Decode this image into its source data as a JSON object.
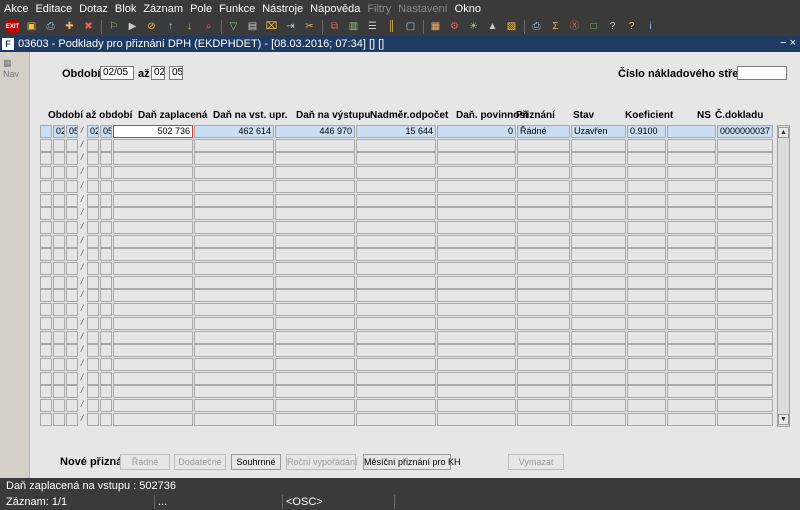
{
  "menu": {
    "items": [
      {
        "label": "Akce",
        "enabled": true
      },
      {
        "label": "Editace",
        "enabled": true
      },
      {
        "label": "Dotaz",
        "enabled": true
      },
      {
        "label": "Blok",
        "enabled": true
      },
      {
        "label": "Záznam",
        "enabled": true
      },
      {
        "label": "Pole",
        "enabled": true
      },
      {
        "label": "Funkce",
        "enabled": true
      },
      {
        "label": "Nástroje",
        "enabled": true
      },
      {
        "label": "Nápověda",
        "enabled": true
      },
      {
        "label": "Filtry",
        "enabled": false
      },
      {
        "label": "Nastavení",
        "enabled": false
      },
      {
        "label": "Okno",
        "enabled": true
      }
    ]
  },
  "toolbar": {
    "exit_label": "EXIT",
    "icons": [
      "save-icon",
      "print-icon",
      "new-record-icon",
      "delete-record-icon",
      "enter-query-icon",
      "execute-query-icon",
      "cancel-query-icon",
      "sort-asc-icon",
      "sort-desc-icon",
      "search-icon",
      "filter-icon",
      "print-preview-icon",
      "clear-icon",
      "export-icon",
      "cut-icon",
      "copy-icon",
      "paste-icon",
      "list-icon",
      "column-icon",
      "window-icon",
      "calendar-icon",
      "settings-icon",
      "sun-icon",
      "triangle-icon",
      "report-icon",
      "printer-icon",
      "sum-icon",
      "excel-icon",
      "monitor-icon",
      "help-icon",
      "question-icon",
      "info-icon"
    ]
  },
  "window": {
    "title": "03603 - Podklady pro přiznání DPH (EKDPHDET) - [08.03.2016; 07:34] [] []",
    "app_icon": "F",
    "controls": "− ×"
  },
  "nav": {
    "label": "Nav"
  },
  "filter": {
    "period_label": "Období:",
    "period_from": "02/05",
    "to_label": "až",
    "period_to_month": "02",
    "period_to_year": "05",
    "cost_center_label": "Číslo nákladového střediska",
    "cost_center_value": ""
  },
  "grid": {
    "headers": {
      "period": "Období až období",
      "paid_tax": "Daň zaplacená",
      "input_tax": "Daň na vst. upr.",
      "output_tax": "Daň na výstupu",
      "excess_deduction": "Nadměr.odpočet",
      "tax_liability": "Daň. povinnost",
      "filing": "Přiznání",
      "state": "Stav",
      "coefficient": "Koeficient",
      "ns": "NS",
      "doc_no": "Č.dokladu"
    },
    "row_count": 22,
    "first_row": {
      "from_month": "02",
      "from_year": "05",
      "to_month": "02",
      "to_year": "05",
      "paid_tax": "502 736",
      "input_tax": "462 614",
      "output_tax": "446 970",
      "excess_deduction": "15 644",
      "tax_liability": "0",
      "filing": "Řádné",
      "state": "Uzavřen",
      "coefficient": "0.9100",
      "ns": "",
      "doc_no": "0000000037"
    }
  },
  "buttons": {
    "new_filing_label": "Nové přiznání",
    "regular": "Řádné",
    "additional": "Dodatečné",
    "summary": "Souhrnné",
    "annual": "Roční vypořádání",
    "monthly_kh": "Měsíční přiznání pro KH",
    "delete": "Vymazat"
  },
  "status": {
    "message": "Daň zaplacená na vstupu : 502736",
    "record": "Záznam: 1/1",
    "dots": "...",
    "osc": "<OSC>"
  },
  "colors": {
    "dark_bar": "#3a3a3a",
    "title_bar": "#1f3a63",
    "panel": "#e6e6e6",
    "filled_cell": "#c9ddf3",
    "active_border": "#d23a3a"
  }
}
